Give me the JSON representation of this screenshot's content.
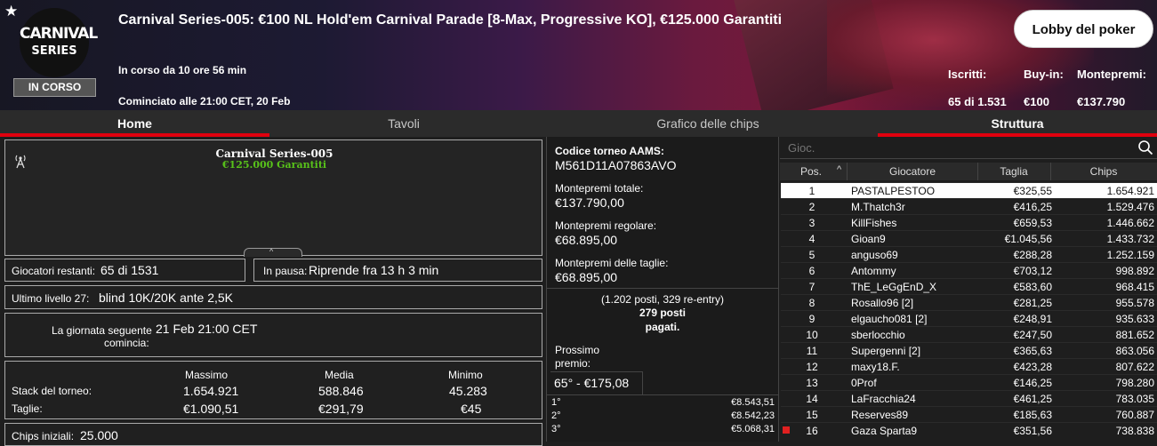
{
  "header": {
    "logo_line1": "CARNIVAL",
    "logo_line2": "SERIES",
    "status_badge": "IN CORSO",
    "title": "Carnival Series-005: €100 NL Hold'em Carnival Parade [8-Max, Progressive KO], €125.000 Garantiti",
    "running_for": "In corso da 10 ore 56 min",
    "started_at": "Cominciato alle 21:00 CET, 20 Feb",
    "lobby_button": "Lobby del poker",
    "stats": {
      "registered_label": "Iscritti:",
      "registered_value": "65 di 1.531",
      "buyin_label": "Buy-in:",
      "buyin_value": "€100",
      "prizepool_label": "Montepremi:",
      "prizepool_value": "€137.790"
    }
  },
  "tabs": [
    {
      "label": "Home"
    },
    {
      "label": "Tavoli"
    },
    {
      "label": "Grafico delle chips"
    },
    {
      "label": "Struttura"
    }
  ],
  "left": {
    "card_title": "Carnival Series-005",
    "card_subtitle": "€125.000 Garantiti",
    "players_left_label": "Giocatori restanti:",
    "players_left_value": "65 di 1531",
    "pause_label": "In pausa:",
    "pause_value": "Riprende fra 13 h 3 min",
    "last_level_label": "Ultimo livello 27:",
    "last_level_value": "blind 10K/20K ante 2,5K",
    "next_day_label1": "La giornata seguente",
    "next_day_label2": "comincia:",
    "next_day_value": "21 Feb 21:00 CET",
    "stack_headers": {
      "max": "Massimo",
      "avg": "Media",
      "min": "Minimo"
    },
    "stack_label": "Stack del torneo:",
    "stack_max": "1.654.921",
    "stack_avg": "588.846",
    "stack_min": "45.283",
    "bounty_label": "Taglie:",
    "bounty_max": "€1.090,51",
    "bounty_avg": "€291,79",
    "bounty_min": "€45",
    "start_chips_label": "Chips iniziali:",
    "start_chips_value": "25.000"
  },
  "middle": {
    "aams_label": "Codice torneo AAMS:",
    "aams_value": "M561D11A07863AVO",
    "total_prize_label": "Montepremi totale:",
    "total_prize_value": "€137.790,00",
    "regular_prize_label": "Montepremi regolare:",
    "regular_prize_value": "€68.895,00",
    "bounty_prize_label": "Montepremi delle taglie:",
    "bounty_prize_value": "€68.895,00",
    "entries_note": "(1.202 posti, 329 re-entry)",
    "paid_line1": "279 posti",
    "paid_line2": "pagati.",
    "next_prize_label1": "Prossimo",
    "next_prize_label2": "premio:",
    "next_prize_value": "65° - €175,08",
    "payouts": [
      {
        "place": "1°",
        "amount": "€8.543,51"
      },
      {
        "place": "2°",
        "amount": "€8.542,23"
      },
      {
        "place": "3°",
        "amount": "€5.068,31"
      }
    ]
  },
  "right": {
    "search_placeholder": "Gioc.",
    "columns": {
      "pos": "Pos.",
      "player": "Giocatore",
      "bounty": "Taglia",
      "chips": "Chips"
    },
    "rows": [
      {
        "pos": "1",
        "player": "PASTALPESTOO",
        "bounty": "€325,55",
        "chips": "1.654.921"
      },
      {
        "pos": "2",
        "player": "M.Thatch3r",
        "bounty": "€416,25",
        "chips": "1.529.476"
      },
      {
        "pos": "3",
        "player": "KillFishes",
        "bounty": "€659,53",
        "chips": "1.446.662"
      },
      {
        "pos": "4",
        "player": "Gioan9",
        "bounty": "€1.045,56",
        "chips": "1.433.732"
      },
      {
        "pos": "5",
        "player": "anguso69",
        "bounty": "€288,28",
        "chips": "1.252.159"
      },
      {
        "pos": "6",
        "player": "Antommy",
        "bounty": "€703,12",
        "chips": "998.892"
      },
      {
        "pos": "7",
        "player": "ThE_LeGgEnD_X",
        "bounty": "€583,60",
        "chips": "968.415"
      },
      {
        "pos": "8",
        "player": "Rosallo96 [2]",
        "bounty": "€281,25",
        "chips": "955.578"
      },
      {
        "pos": "9",
        "player": "elgaucho081 [2]",
        "bounty": "€248,91",
        "chips": "935.633"
      },
      {
        "pos": "10",
        "player": "sberlocchio",
        "bounty": "€247,50",
        "chips": "881.652"
      },
      {
        "pos": "11",
        "player": "Supergenni [2]",
        "bounty": "€365,63",
        "chips": "863.056"
      },
      {
        "pos": "12",
        "player": "maxy18.F.",
        "bounty": "€423,28",
        "chips": "807.622"
      },
      {
        "pos": "13",
        "player": "0Prof",
        "bounty": "€146,25",
        "chips": "798.280"
      },
      {
        "pos": "14",
        "player": "LaFracchia24",
        "bounty": "€461,25",
        "chips": "783.035"
      },
      {
        "pos": "15",
        "player": "Reserves89",
        "bounty": "€185,63",
        "chips": "760.887"
      },
      {
        "pos": "16",
        "player": "Gaza Sparta9",
        "bounty": "€351,56",
        "chips": "738.838"
      }
    ]
  },
  "colors": {
    "accent": "#e0000e",
    "guarantee_green": "#58c21a"
  }
}
